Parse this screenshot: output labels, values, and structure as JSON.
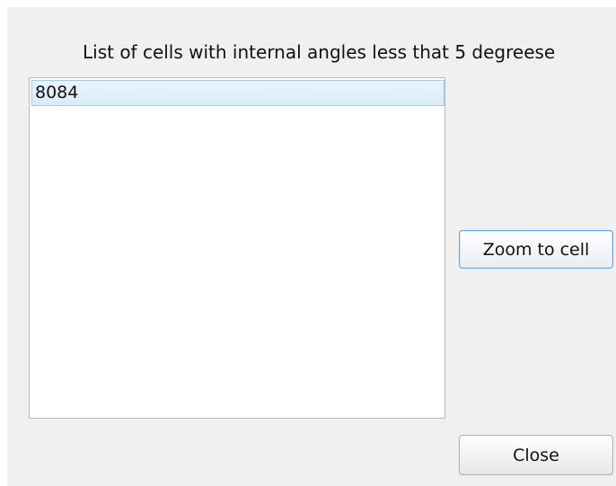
{
  "dialog": {
    "heading": "List of cells with internal angles less that 5 degreese",
    "cell_list": {
      "items": [
        "8084"
      ],
      "selected_index": 0
    },
    "buttons": {
      "zoom_label": "Zoom to cell",
      "close_label": "Close"
    }
  }
}
